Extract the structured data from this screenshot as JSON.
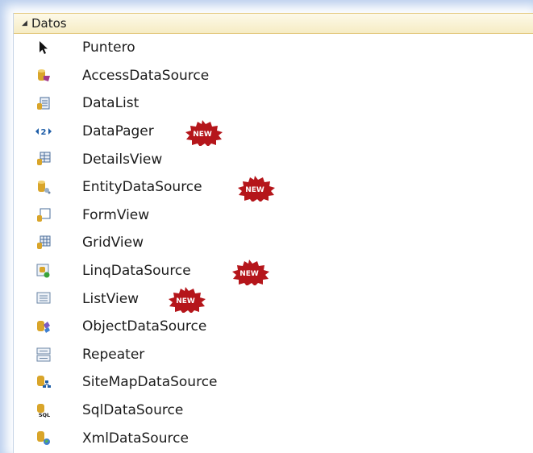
{
  "header": {
    "title": "Datos"
  },
  "items": [
    {
      "label": "Puntero",
      "icon": "pointer-icon",
      "new": false
    },
    {
      "label": "AccessDataSource",
      "icon": "access-datasource-icon",
      "new": false
    },
    {
      "label": "DataList",
      "icon": "datalist-icon",
      "new": false
    },
    {
      "label": "DataPager",
      "icon": "datapager-icon",
      "new": true
    },
    {
      "label": "DetailsView",
      "icon": "detailsview-icon",
      "new": false
    },
    {
      "label": "EntityDataSource",
      "icon": "entity-datasource-icon",
      "new": true
    },
    {
      "label": "FormView",
      "icon": "formview-icon",
      "new": false
    },
    {
      "label": "GridView",
      "icon": "gridview-icon",
      "new": false
    },
    {
      "label": "LinqDataSource",
      "icon": "linq-datasource-icon",
      "new": true
    },
    {
      "label": "ListView",
      "icon": "listview-icon",
      "new": true
    },
    {
      "label": "ObjectDataSource",
      "icon": "object-datasource-icon",
      "new": false
    },
    {
      "label": "Repeater",
      "icon": "repeater-icon",
      "new": false
    },
    {
      "label": "SiteMapDataSource",
      "icon": "sitemap-datasource-icon",
      "new": false
    },
    {
      "label": "SqlDataSource",
      "icon": "sql-datasource-icon",
      "new": false
    },
    {
      "label": "XmlDataSource",
      "icon": "xml-datasource-icon",
      "new": false
    }
  ],
  "badge": {
    "text": "NEW",
    "color": "#b5161b"
  },
  "colors": {
    "header_bg": "#f6ecc4",
    "header_border": "#e2c77a",
    "db_gold": "#d9a52a"
  }
}
